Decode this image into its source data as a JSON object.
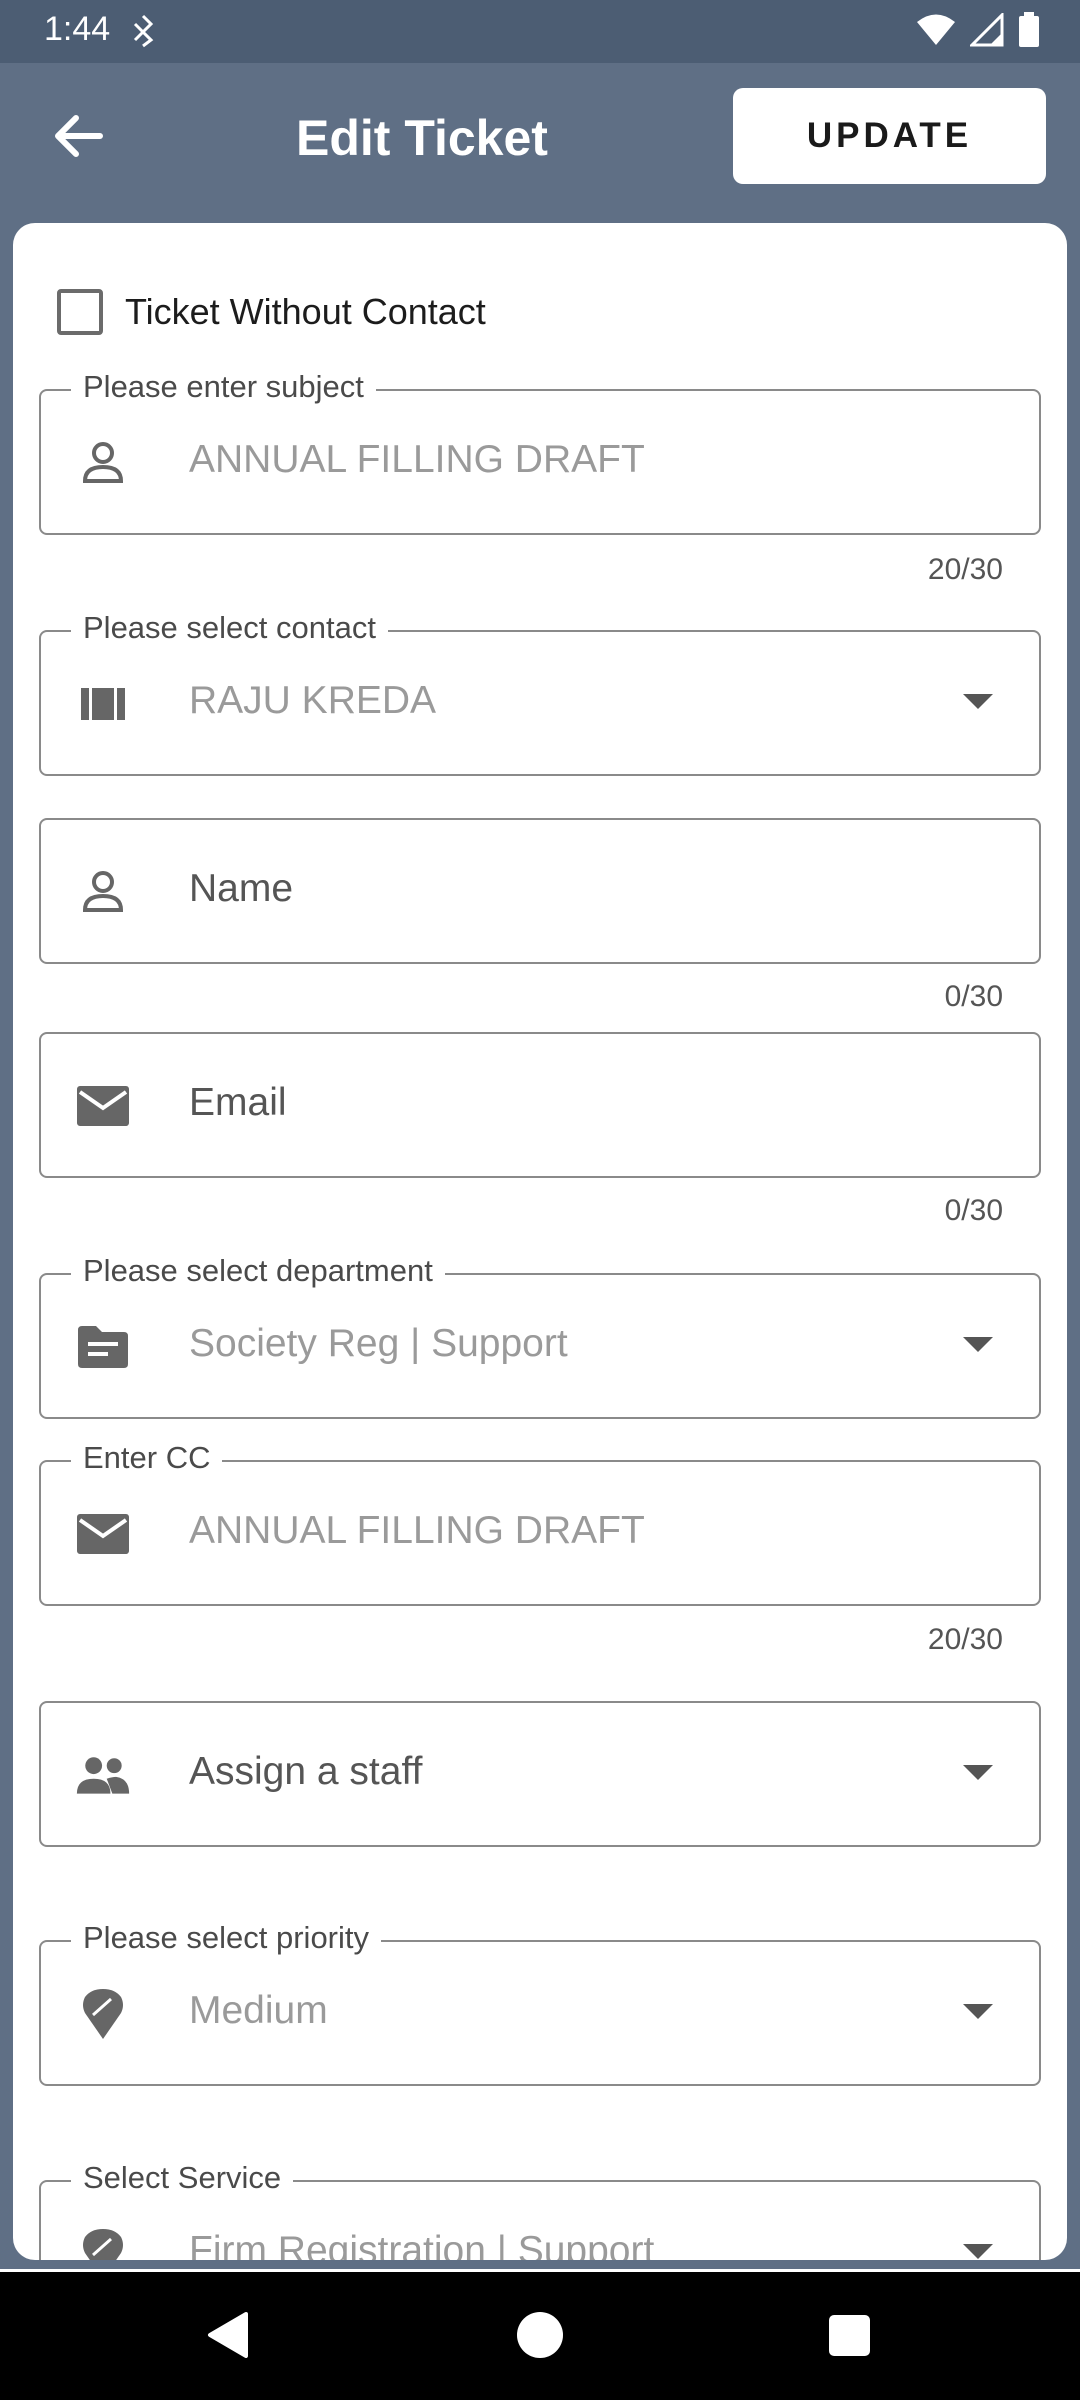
{
  "status_bar": {
    "time": "1:44",
    "icons": [
      "nfc-icon",
      "wifi-icon",
      "signal-icon",
      "battery-icon"
    ]
  },
  "app_bar": {
    "title": "Edit Ticket",
    "update_label": "UPDATE",
    "back_icon": "arrow-left-icon"
  },
  "form": {
    "checkbox_label": "Ticket Without Contact",
    "subject": {
      "label": "Please enter subject",
      "value": "ANNUAL FILLING DRAFT",
      "counter": "20/30",
      "icon": "person-icon"
    },
    "contact": {
      "label": "Please select contact",
      "value": "RAJU KREDA",
      "icon": "contact-card-icon"
    },
    "name": {
      "placeholder": "Name",
      "counter": "0/30",
      "icon": "person-icon"
    },
    "email": {
      "placeholder": "Email",
      "counter": "0/30",
      "icon": "email-icon"
    },
    "department": {
      "label": "Please select department",
      "value": "Society Reg | Support",
      "icon": "folder-icon"
    },
    "cc": {
      "label": "Enter CC",
      "value": "ANNUAL FILLING DRAFT",
      "counter": "20/30",
      "icon": "email-icon"
    },
    "staff": {
      "placeholder": "Assign a staff",
      "icon": "people-icon"
    },
    "priority": {
      "label": "Please select priority",
      "value": "Medium",
      "icon": "pin-icon"
    },
    "service": {
      "label": "Select Service",
      "value": "Firm Registration | Support",
      "icon": "pin-icon"
    }
  },
  "colors": {
    "status_bar": "#4c5d73",
    "app_bar": "#5f6f85",
    "card": "#ffffff",
    "nav_bar": "#000000"
  }
}
